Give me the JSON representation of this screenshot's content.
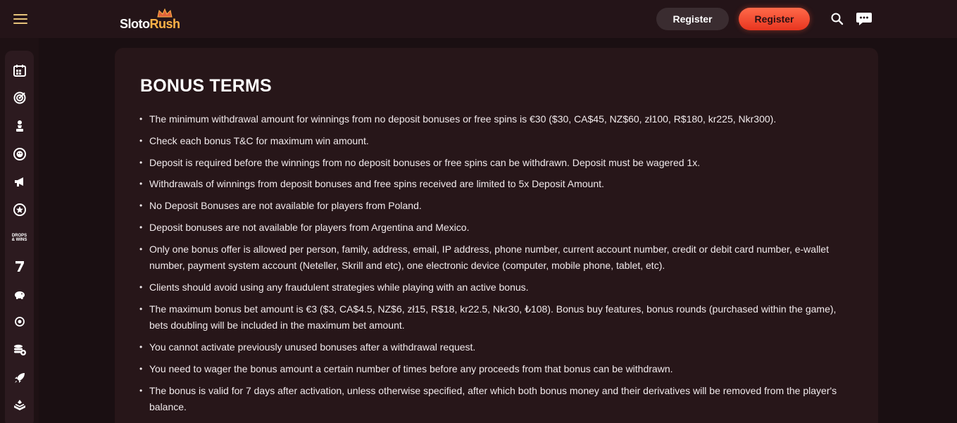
{
  "header": {
    "logo_slo": "Sloto",
    "logo_rush": "Rush",
    "register_secondary": "Register",
    "register_primary": "Register",
    "icons": [
      "menu-icon",
      "search-icon",
      "chat-icon"
    ]
  },
  "sidebar": {
    "items": [
      {
        "icon": "calendar-icon"
      },
      {
        "icon": "target-icon"
      },
      {
        "icon": "chess-pawn-icon"
      },
      {
        "icon": "face-badge-icon"
      },
      {
        "icon": "megaphone-icon"
      },
      {
        "icon": "star-circle-icon"
      },
      {
        "icon": "drops-wins-icon",
        "label_top": "DROPS",
        "label_bottom": "& WINS"
      },
      {
        "icon": "seven-icon"
      },
      {
        "icon": "piggy-bank-icon"
      },
      {
        "icon": "bullseye-icon"
      },
      {
        "icon": "coins-icon"
      },
      {
        "icon": "rocket-icon"
      },
      {
        "icon": "stack-icon"
      }
    ]
  },
  "main": {
    "title": "BONUS TERMS",
    "terms": [
      "The minimum withdrawal amount for winnings from no deposit bonuses or free spins is €30 ($30, CA$45, NZ$60, zł100, R$180, kr225, Nkr300).",
      "Check each bonus T&C for maximum win amount.",
      "Deposit is required before the winnings from no deposit bonuses or free spins can be withdrawn. Deposit must be wagered 1x.",
      "Withdrawals of winnings from deposit bonuses and free spins received are limited to 5x Deposit Amount.",
      "No Deposit Bonuses are not available for players from Poland.",
      "Deposit bonuses are not available for players from Argentina and Mexico.",
      "Only one bonus offer is allowed per person, family, address, email, IP address, phone number, current account number, credit or debit card number, e-wallet number, payment system account (Neteller, Skrill and etc), one electronic device (computer, mobile phone, tablet, etc).",
      "Clients should avoid using any fraudulent strategies while playing with an active bonus.",
      "The maximum bonus bet amount is €3 ($3, CA$4.5, NZ$6, zł15, R$18, kr22.5, Nkr30, ₺108). Bonus buy features, bonus rounds (purchased within the game), bets doubling will be included in the maximum bet amount.",
      "You cannot activate previously unused bonuses after a withdrawal request.",
      "You need to wager the bonus amount a certain number of times before any proceeds from that bonus can be withdrawn.",
      "The bonus is valid for 7 days after activation, unless otherwise specified, after which both bonus money and their derivatives will be removed from the player's balance."
    ]
  },
  "colors": {
    "background": "#1e1114",
    "card": "#271619",
    "accent": "#ff5a3c",
    "logo_accent": "#ffb347"
  }
}
